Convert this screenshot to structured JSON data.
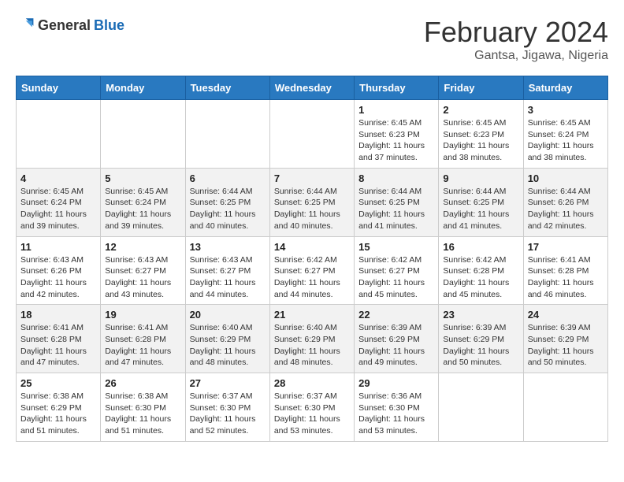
{
  "header": {
    "logo_general": "General",
    "logo_blue": "Blue",
    "title": "February 2024",
    "subtitle": "Gantsa, Jigawa, Nigeria"
  },
  "weekdays": [
    "Sunday",
    "Monday",
    "Tuesday",
    "Wednesday",
    "Thursday",
    "Friday",
    "Saturday"
  ],
  "weeks": [
    [
      {
        "day": "",
        "info": ""
      },
      {
        "day": "",
        "info": ""
      },
      {
        "day": "",
        "info": ""
      },
      {
        "day": "",
        "info": ""
      },
      {
        "day": "1",
        "info": "Sunrise: 6:45 AM\nSunset: 6:23 PM\nDaylight: 11 hours and 37 minutes."
      },
      {
        "day": "2",
        "info": "Sunrise: 6:45 AM\nSunset: 6:23 PM\nDaylight: 11 hours and 38 minutes."
      },
      {
        "day": "3",
        "info": "Sunrise: 6:45 AM\nSunset: 6:24 PM\nDaylight: 11 hours and 38 minutes."
      }
    ],
    [
      {
        "day": "4",
        "info": "Sunrise: 6:45 AM\nSunset: 6:24 PM\nDaylight: 11 hours and 39 minutes."
      },
      {
        "day": "5",
        "info": "Sunrise: 6:45 AM\nSunset: 6:24 PM\nDaylight: 11 hours and 39 minutes."
      },
      {
        "day": "6",
        "info": "Sunrise: 6:44 AM\nSunset: 6:25 PM\nDaylight: 11 hours and 40 minutes."
      },
      {
        "day": "7",
        "info": "Sunrise: 6:44 AM\nSunset: 6:25 PM\nDaylight: 11 hours and 40 minutes."
      },
      {
        "day": "8",
        "info": "Sunrise: 6:44 AM\nSunset: 6:25 PM\nDaylight: 11 hours and 41 minutes."
      },
      {
        "day": "9",
        "info": "Sunrise: 6:44 AM\nSunset: 6:25 PM\nDaylight: 11 hours and 41 minutes."
      },
      {
        "day": "10",
        "info": "Sunrise: 6:44 AM\nSunset: 6:26 PM\nDaylight: 11 hours and 42 minutes."
      }
    ],
    [
      {
        "day": "11",
        "info": "Sunrise: 6:43 AM\nSunset: 6:26 PM\nDaylight: 11 hours and 42 minutes."
      },
      {
        "day": "12",
        "info": "Sunrise: 6:43 AM\nSunset: 6:27 PM\nDaylight: 11 hours and 43 minutes."
      },
      {
        "day": "13",
        "info": "Sunrise: 6:43 AM\nSunset: 6:27 PM\nDaylight: 11 hours and 44 minutes."
      },
      {
        "day": "14",
        "info": "Sunrise: 6:42 AM\nSunset: 6:27 PM\nDaylight: 11 hours and 44 minutes."
      },
      {
        "day": "15",
        "info": "Sunrise: 6:42 AM\nSunset: 6:27 PM\nDaylight: 11 hours and 45 minutes."
      },
      {
        "day": "16",
        "info": "Sunrise: 6:42 AM\nSunset: 6:28 PM\nDaylight: 11 hours and 45 minutes."
      },
      {
        "day": "17",
        "info": "Sunrise: 6:41 AM\nSunset: 6:28 PM\nDaylight: 11 hours and 46 minutes."
      }
    ],
    [
      {
        "day": "18",
        "info": "Sunrise: 6:41 AM\nSunset: 6:28 PM\nDaylight: 11 hours and 47 minutes."
      },
      {
        "day": "19",
        "info": "Sunrise: 6:41 AM\nSunset: 6:28 PM\nDaylight: 11 hours and 47 minutes."
      },
      {
        "day": "20",
        "info": "Sunrise: 6:40 AM\nSunset: 6:29 PM\nDaylight: 11 hours and 48 minutes."
      },
      {
        "day": "21",
        "info": "Sunrise: 6:40 AM\nSunset: 6:29 PM\nDaylight: 11 hours and 48 minutes."
      },
      {
        "day": "22",
        "info": "Sunrise: 6:39 AM\nSunset: 6:29 PM\nDaylight: 11 hours and 49 minutes."
      },
      {
        "day": "23",
        "info": "Sunrise: 6:39 AM\nSunset: 6:29 PM\nDaylight: 11 hours and 50 minutes."
      },
      {
        "day": "24",
        "info": "Sunrise: 6:39 AM\nSunset: 6:29 PM\nDaylight: 11 hours and 50 minutes."
      }
    ],
    [
      {
        "day": "25",
        "info": "Sunrise: 6:38 AM\nSunset: 6:29 PM\nDaylight: 11 hours and 51 minutes."
      },
      {
        "day": "26",
        "info": "Sunrise: 6:38 AM\nSunset: 6:30 PM\nDaylight: 11 hours and 51 minutes."
      },
      {
        "day": "27",
        "info": "Sunrise: 6:37 AM\nSunset: 6:30 PM\nDaylight: 11 hours and 52 minutes."
      },
      {
        "day": "28",
        "info": "Sunrise: 6:37 AM\nSunset: 6:30 PM\nDaylight: 11 hours and 53 minutes."
      },
      {
        "day": "29",
        "info": "Sunrise: 6:36 AM\nSunset: 6:30 PM\nDaylight: 11 hours and 53 minutes."
      },
      {
        "day": "",
        "info": ""
      },
      {
        "day": "",
        "info": ""
      }
    ]
  ]
}
